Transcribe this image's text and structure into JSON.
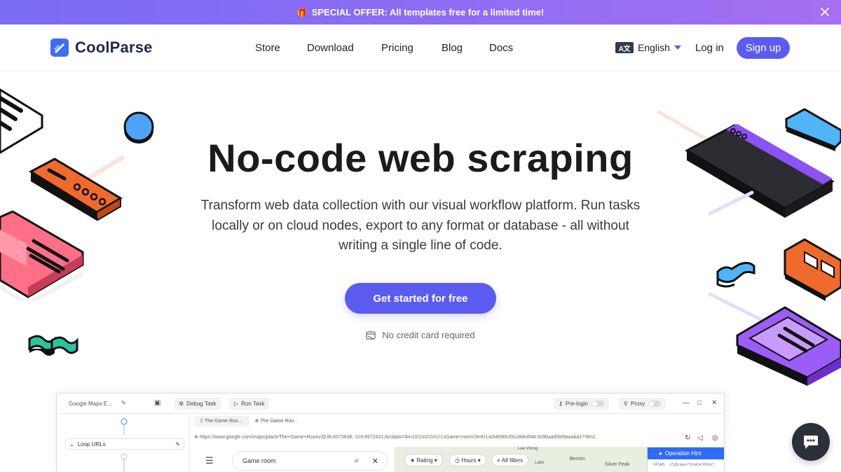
{
  "promo": {
    "text": "SPECIAL OFFER: All templates free for a limited time!",
    "gift": "🎁"
  },
  "brand": {
    "name": "CoolParse",
    "accent": "#5b5bf0"
  },
  "nav": {
    "items": [
      "Store",
      "Download",
      "Pricing",
      "Blog",
      "Docs"
    ]
  },
  "lang": {
    "label": "English",
    "icon": "translate-icon"
  },
  "auth": {
    "login": "Log in",
    "signup": "Sign up"
  },
  "hero": {
    "title": "No-code web scraping",
    "subtitle": "Transform web data collection with our visual workflow platform. Run tasks locally or on cloud nodes, export to any format or database - all without writing a single line of code.",
    "cta": "Get started for free",
    "note": "No credit card required"
  },
  "app": {
    "task_name": "Google Maps E...",
    "debug": "Debug Task",
    "run": "Run Task",
    "prelogin": "Pre-login",
    "proxy": "Proxy",
    "loop": "Loop URLs",
    "tab1": "The Game Roo...",
    "tab2": "The Game Roo...",
    "url": "https://www.google.com/maps/place/The+Game+Room/@36.6573638,-119.8972431,8z/data=!4m10!1m2!2m1!1sGame+room!3m6!1s0x8090cf0cc8de4f4d:0x9baad5bf9aaaba17!8m2",
    "search_value": "Game room",
    "filters": {
      "rating": "Rating",
      "hours": "Hours",
      "all": "All filters"
    },
    "map_labels": {
      "a": "Benton",
      "b": "Silver Peak",
      "c": "Lake",
      "d": "Lee Vining"
    },
    "hint": "Operation Hint",
    "hint_xpath": "XPath",
    "hint_code": "//*[@class=\"DUwDvf lfPIob\"]"
  }
}
